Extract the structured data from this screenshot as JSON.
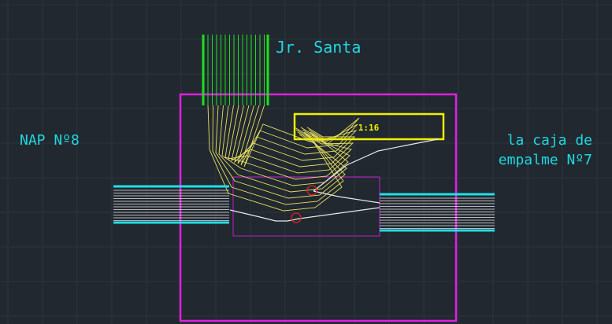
{
  "labels": {
    "street": "Jr. Santa",
    "nap": "NAP Nº8",
    "splice_line1": "la caja de",
    "splice_line2": "empalme Nº7",
    "box_text": "1:16"
  },
  "colors": {
    "background": "#212830",
    "grid": "#2b333c",
    "boundary": "#e020e0",
    "cable_street": "#22dd22",
    "cable_side": "#20e0e8",
    "fiber": "#e8e060",
    "box": "#f0f000",
    "route": "#e8e8e8",
    "marker": "#e02020",
    "text": "#20d8e0"
  },
  "icons": {
    "splice_marker": "circle-marker-icon"
  }
}
